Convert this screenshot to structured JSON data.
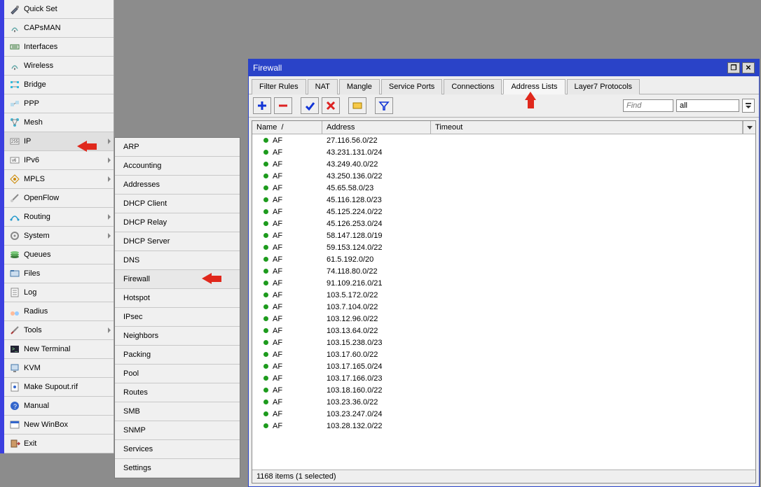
{
  "main_menu": [
    {
      "label": "Quick Set",
      "submenu": false
    },
    {
      "label": "CAPsMAN",
      "submenu": false
    },
    {
      "label": "Interfaces",
      "submenu": false
    },
    {
      "label": "Wireless",
      "submenu": false
    },
    {
      "label": "Bridge",
      "submenu": false
    },
    {
      "label": "PPP",
      "submenu": false
    },
    {
      "label": "Mesh",
      "submenu": false
    },
    {
      "label": "IP",
      "submenu": true,
      "active": true
    },
    {
      "label": "IPv6",
      "submenu": true
    },
    {
      "label": "MPLS",
      "submenu": true
    },
    {
      "label": "OpenFlow",
      "submenu": false
    },
    {
      "label": "Routing",
      "submenu": true
    },
    {
      "label": "System",
      "submenu": true
    },
    {
      "label": "Queues",
      "submenu": false
    },
    {
      "label": "Files",
      "submenu": false
    },
    {
      "label": "Log",
      "submenu": false
    },
    {
      "label": "Radius",
      "submenu": false
    },
    {
      "label": "Tools",
      "submenu": true
    },
    {
      "label": "New Terminal",
      "submenu": false
    },
    {
      "label": "KVM",
      "submenu": false
    },
    {
      "label": "Make Supout.rif",
      "submenu": false
    },
    {
      "label": "Manual",
      "submenu": false
    },
    {
      "label": "New WinBox",
      "submenu": false
    },
    {
      "label": "Exit",
      "submenu": false
    }
  ],
  "ip_submenu": [
    "ARP",
    "Accounting",
    "Addresses",
    "DHCP Client",
    "DHCP Relay",
    "DHCP Server",
    "DNS",
    "Firewall",
    "Hotspot",
    "IPsec",
    "Neighbors",
    "Packing",
    "Pool",
    "Routes",
    "SMB",
    "SNMP",
    "Services",
    "Settings"
  ],
  "ip_submenu_selected": "Firewall",
  "firewall": {
    "title": "Firewall",
    "tabs": [
      "Filter Rules",
      "NAT",
      "Mangle",
      "Service Ports",
      "Connections",
      "Address Lists",
      "Layer7 Protocols"
    ],
    "active_tab": "Address Lists",
    "find_placeholder": "Find",
    "filter_value": "all",
    "columns": [
      "Name",
      "Address",
      "Timeout"
    ],
    "status": "1168 items (1 selected)",
    "rows": [
      {
        "name": "AF",
        "address": "27.116.56.0/22"
      },
      {
        "name": "AF",
        "address": "43.231.131.0/24"
      },
      {
        "name": "AF",
        "address": "43.249.40.0/22"
      },
      {
        "name": "AF",
        "address": "43.250.136.0/22"
      },
      {
        "name": "AF",
        "address": "45.65.58.0/23"
      },
      {
        "name": "AF",
        "address": "45.116.128.0/23"
      },
      {
        "name": "AF",
        "address": "45.125.224.0/22"
      },
      {
        "name": "AF",
        "address": "45.126.253.0/24"
      },
      {
        "name": "AF",
        "address": "58.147.128.0/19"
      },
      {
        "name": "AF",
        "address": "59.153.124.0/22"
      },
      {
        "name": "AF",
        "address": "61.5.192.0/20"
      },
      {
        "name": "AF",
        "address": "74.118.80.0/22"
      },
      {
        "name": "AF",
        "address": "91.109.216.0/21"
      },
      {
        "name": "AF",
        "address": "103.5.172.0/22"
      },
      {
        "name": "AF",
        "address": "103.7.104.0/22"
      },
      {
        "name": "AF",
        "address": "103.12.96.0/22"
      },
      {
        "name": "AF",
        "address": "103.13.64.0/22"
      },
      {
        "name": "AF",
        "address": "103.15.238.0/23"
      },
      {
        "name": "AF",
        "address": "103.17.60.0/22"
      },
      {
        "name": "AF",
        "address": "103.17.165.0/24"
      },
      {
        "name": "AF",
        "address": "103.17.166.0/23"
      },
      {
        "name": "AF",
        "address": "103.18.160.0/22"
      },
      {
        "name": "AF",
        "address": "103.23.36.0/22"
      },
      {
        "name": "AF",
        "address": "103.23.247.0/24"
      },
      {
        "name": "AF",
        "address": "103.28.132.0/22"
      }
    ]
  }
}
